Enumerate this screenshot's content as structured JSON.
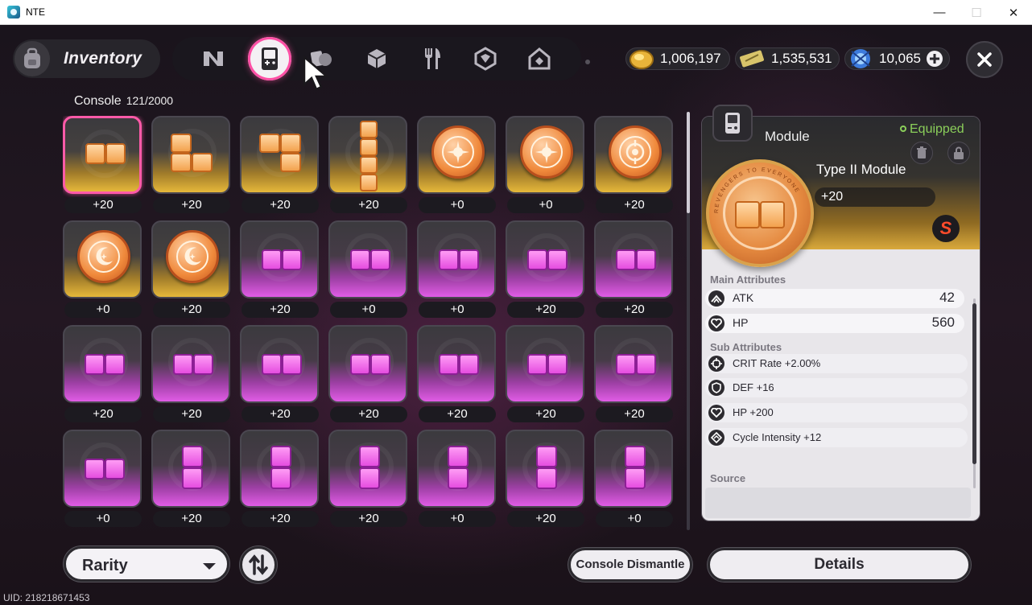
{
  "window": {
    "title": "NTE",
    "minimize": "—",
    "maximize": "☐",
    "close": "✕"
  },
  "header": {
    "inventory_label": "Inventory",
    "tabs": [
      "n-logo-icon",
      "console-icon",
      "card-icon",
      "cube-icon",
      "fork-knife-icon",
      "diamond-box-icon",
      "home-icon"
    ],
    "currencies": [
      {
        "name": "gold-coin",
        "value": "1,006,197",
        "color": "#e8b43a"
      },
      {
        "name": "ticket",
        "value": "1,535,531",
        "color": "#d8c46a"
      },
      {
        "name": "crystal",
        "value": "10,065",
        "color": "#3d7bdc"
      }
    ]
  },
  "console": {
    "label": "Console",
    "count": "121/2000"
  },
  "grid": [
    [
      {
        "kind": "gold",
        "shape": "h2o",
        "lvl": "+20",
        "selected": true
      },
      {
        "kind": "gold",
        "shape": "L",
        "lvl": "+20"
      },
      {
        "kind": "gold",
        "shape": "J",
        "lvl": "+20"
      },
      {
        "kind": "gold",
        "shape": "I4",
        "lvl": "+20"
      },
      {
        "kind": "gold",
        "shape": "coin-sun",
        "lvl": "+0"
      },
      {
        "kind": "gold",
        "shape": "coin-sun",
        "lvl": "+0"
      },
      {
        "kind": "gold",
        "shape": "coin-target",
        "lvl": "+20"
      }
    ],
    [
      {
        "kind": "gold",
        "shape": "coin-moon",
        "lvl": "+0"
      },
      {
        "kind": "gold",
        "shape": "coin-moon",
        "lvl": "+20"
      },
      {
        "kind": "pink",
        "shape": "h2p",
        "lvl": "+20"
      },
      {
        "kind": "pink",
        "shape": "h2p",
        "lvl": "+0"
      },
      {
        "kind": "pink",
        "shape": "h2p",
        "lvl": "+0"
      },
      {
        "kind": "pink",
        "shape": "h2p",
        "lvl": "+20"
      },
      {
        "kind": "pink",
        "shape": "h2p",
        "lvl": "+20"
      }
    ],
    [
      {
        "kind": "pink",
        "shape": "h2p",
        "lvl": "+20"
      },
      {
        "kind": "pink",
        "shape": "h2p",
        "lvl": "+20"
      },
      {
        "kind": "pink",
        "shape": "h2p",
        "lvl": "+20"
      },
      {
        "kind": "pink",
        "shape": "h2p",
        "lvl": "+20"
      },
      {
        "kind": "pink",
        "shape": "h2p",
        "lvl": "+20"
      },
      {
        "kind": "pink",
        "shape": "h2p",
        "lvl": "+20"
      },
      {
        "kind": "pink",
        "shape": "h2p",
        "lvl": "+20"
      }
    ],
    [
      {
        "kind": "pink",
        "shape": "h2p",
        "lvl": "+0"
      },
      {
        "kind": "pink",
        "shape": "v2p",
        "lvl": "+20"
      },
      {
        "kind": "pink",
        "shape": "v2p",
        "lvl": "+20"
      },
      {
        "kind": "pink",
        "shape": "v2p",
        "lvl": "+20"
      },
      {
        "kind": "pink",
        "shape": "v2p",
        "lvl": "+0"
      },
      {
        "kind": "pink",
        "shape": "v2p",
        "lvl": "+20"
      },
      {
        "kind": "pink",
        "shape": "v2p",
        "lvl": "+0"
      }
    ]
  ],
  "detail": {
    "category": "Module",
    "status": "Equipped",
    "name": "Type II Module",
    "level": "+20",
    "coin_text": "REVENGERS TO EVERYONE",
    "badge": "S",
    "main_title": "Main Attributes",
    "main": [
      {
        "name": "ATK",
        "value": "42",
        "icon": "atk-icon"
      },
      {
        "name": "HP",
        "value": "560",
        "icon": "hp-icon"
      }
    ],
    "sub_title": "Sub Attributes",
    "sub": [
      {
        "name": "CRIT Rate +2.00%",
        "icon": "crit-icon"
      },
      {
        "name": "DEF +16",
        "icon": "def-icon"
      },
      {
        "name": "HP +200",
        "icon": "hp-icon"
      },
      {
        "name": "Cycle Intensity +12",
        "icon": "cycle-icon"
      }
    ],
    "source_title": "Source"
  },
  "footer": {
    "rarity": "Rarity",
    "dismantle": "Console Dismantle",
    "details": "Details",
    "uid": "UID: 218218671453"
  }
}
